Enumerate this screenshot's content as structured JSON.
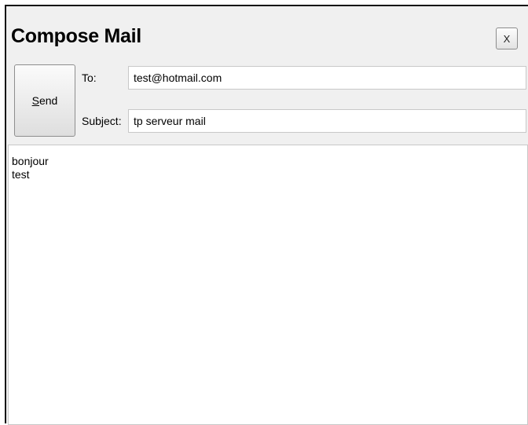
{
  "window": {
    "title": "Compose Mail",
    "close_label": "X"
  },
  "toolbar": {
    "send_label_mnemonic": "S",
    "send_label_rest": "end"
  },
  "fields": {
    "to_label": "To:",
    "to_value": "test@hotmail.com",
    "subject_label": "Subject:",
    "subject_value": "tp serveur mail"
  },
  "message": {
    "body": "bonjour\ntest"
  },
  "colors": {
    "window_background": "#f0f0f0",
    "input_background": "#ffffff",
    "border": "#c8c8c8"
  }
}
